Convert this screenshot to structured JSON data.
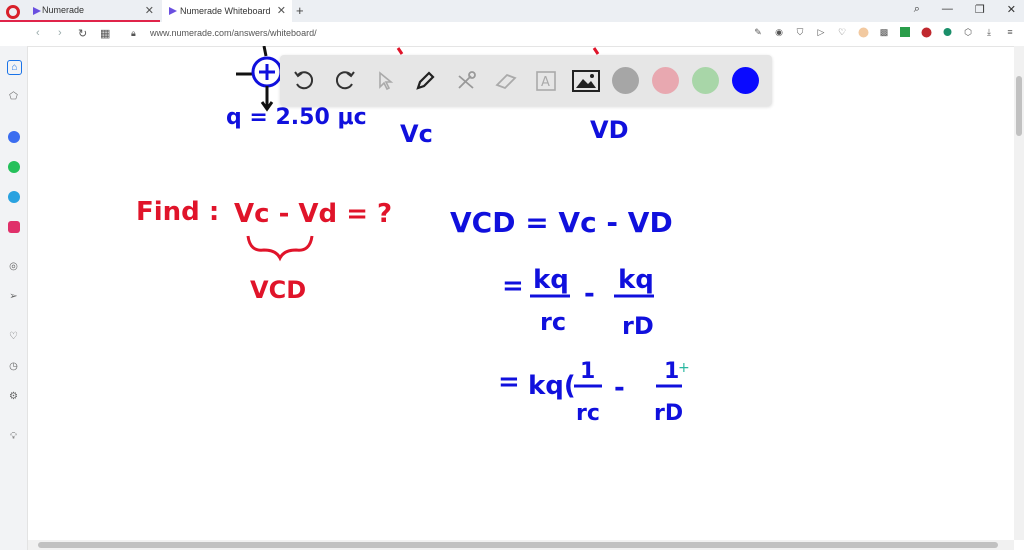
{
  "browser": {
    "tabs": [
      {
        "label": "Numerade",
        "active": false
      },
      {
        "label": "Numerade Whiteboard",
        "active": true
      }
    ],
    "url": "www.numerade.com/answers/whiteboard/"
  },
  "whiteboard": {
    "charge_label": "q = 2.50 μc",
    "vc_label": "Vc",
    "vd_label": "VD",
    "find_label": "Find :",
    "find_expr": "Vc - Vd = ?",
    "vcd_under": "VCD",
    "eq1": "VCD = Vc - VD",
    "eq2_num1": "kq",
    "eq2_den1": "rc",
    "eq2_num2": "kq",
    "eq2_den2": "rD",
    "eq3": "= kq(1/rc - 1/rD"
  },
  "toolbar": {
    "tools": [
      "undo-icon",
      "redo-icon",
      "pointer-icon",
      "pen-icon",
      "tools-icon",
      "eraser-icon",
      "text-icon",
      "image-icon"
    ],
    "colors": [
      "#a6a6a6",
      "#e8a8b0",
      "#a8d6a8",
      "#0a0aff"
    ]
  },
  "colors": {
    "ink_blue": "#1010dd",
    "ink_red": "#e0142a",
    "accent": "#e0244a"
  }
}
